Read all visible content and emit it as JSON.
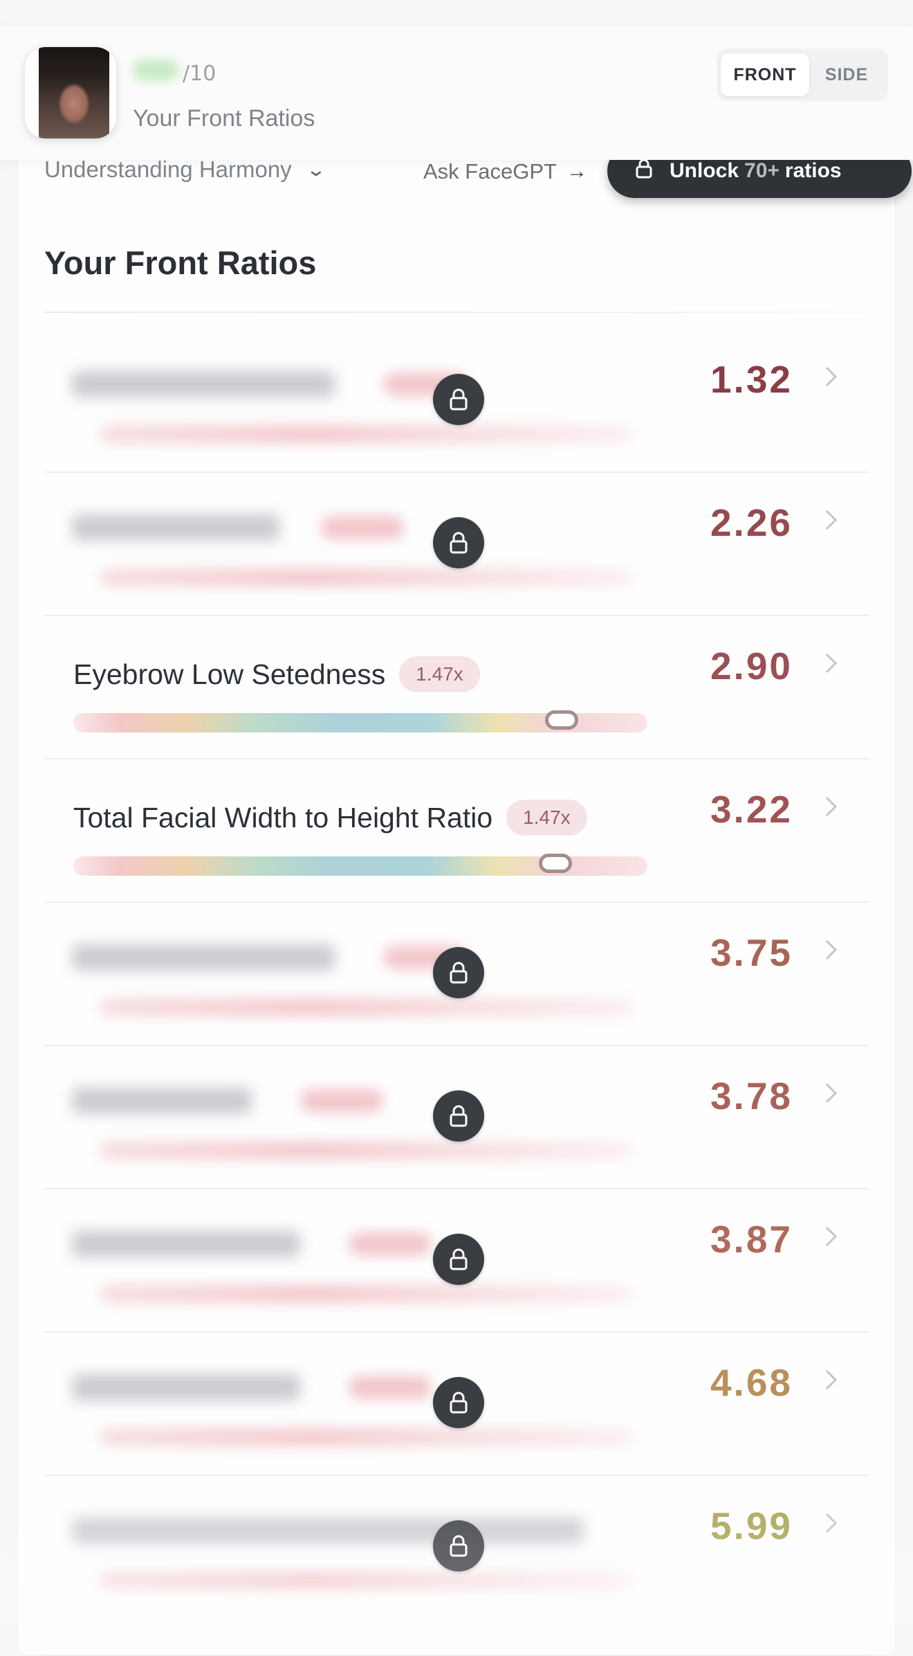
{
  "header": {
    "score_suffix": "/10",
    "subtitle": "Your Front Ratios",
    "tabs": {
      "front": "FRONT",
      "side": "SIDE"
    }
  },
  "toolbar": {
    "harmony_label": "Understanding Harmony",
    "ask_label": "Ask FaceGPT",
    "unlock_prefix": "Unlock",
    "unlock_count": "70+",
    "unlock_suffix": "ratios"
  },
  "section": {
    "title": "Your Front Ratios"
  },
  "rows": [
    {
      "value": "1.32",
      "locked": true,
      "color": "#8a3d44"
    },
    {
      "value": "2.26",
      "locked": true,
      "color": "#954a4f"
    },
    {
      "value": "2.90",
      "locked": false,
      "label": "Eyebrow Low Setedness",
      "badge": "1.47x",
      "color": "#9c4f54",
      "marker": 0.85
    },
    {
      "value": "3.22",
      "locked": false,
      "label": "Total Facial Width to Height Ratio",
      "badge": "1.47x",
      "color": "#a05355",
      "marker": 0.84
    },
    {
      "value": "3.75",
      "locked": true,
      "color": "#a96458"
    },
    {
      "value": "3.78",
      "locked": true,
      "color": "#a9625a"
    },
    {
      "value": "3.87",
      "locked": true,
      "color": "#ae6a5c"
    },
    {
      "value": "4.68",
      "locked": true,
      "color": "#b9905c"
    },
    {
      "value": "5.99",
      "locked": true,
      "color": "#a9a14f"
    }
  ],
  "colors": {
    "accent_dark": "#2f3237",
    "badge_bg": "#f6e3e5",
    "badge_text": "#9b5c63"
  },
  "icons": [
    "lock-icon",
    "chevron-right-icon",
    "chevron-down-icon",
    "arrow-right-icon"
  ]
}
